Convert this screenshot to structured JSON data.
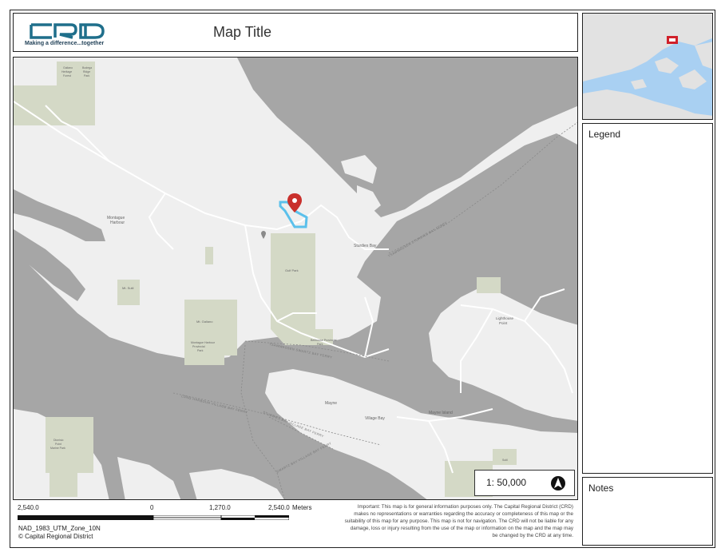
{
  "header": {
    "logo_text": "CRD",
    "logo_tagline": "Making a difference...together",
    "map_title": "Map Title"
  },
  "map": {
    "labels": {
      "montague_harbour": [
        "Montague",
        "Harbour"
      ],
      "sturdies_bay": "Sturdies Bay",
      "mt_galiano": "Mt. Galiano",
      "mt_sutil": "Mt. Sutil",
      "galiano_park": [
        "Montague Harbour",
        "Provincial",
        "Park"
      ],
      "bellhouse_park": [
        "Bellhouse Provincial",
        "Park"
      ],
      "gulf_park": "Gulf Park",
      "lighthouse_point": [
        "Lighthouse",
        "Point"
      ],
      "village_bay": "Village Bay",
      "mayne_island": "Mayne Island",
      "mayne_label": "Mayne",
      "heritage_forest": [
        "Galiano",
        "Heritage",
        "Forest"
      ],
      "dionisio": [
        "Dionisio",
        "Point",
        "Marine Park"
      ],
      "bodega": [
        "Bodega",
        "Ridge",
        "Park"
      ],
      "sutil": "Sutil"
    },
    "ferry_routes": {
      "sturdies_tsawwassen": "TSAWWASSEN STURDIES BAY FERRY",
      "tsawwassen_swartz": "TSAWWASSEN SWARTZ BAY FERRY",
      "long_harbour_village": "LONG HARBOUR VILLAGE BAY FERRY",
      "sturdies_village": "STURDIES BAY VILLAGE BAY FERRY",
      "swartz_village": "SWARTZ BAY VILLAGE BAY FERRY"
    },
    "colors": {
      "water": "#a6a6a6",
      "land": "#efefef",
      "park": "#d4d9c6",
      "road": "#ffffff",
      "marker": "#c9302c",
      "highlight": "#5bc0eb"
    }
  },
  "overview_map": {
    "colors": {
      "water": "#a9d0f2",
      "land": "#e2e2e2",
      "marker": "#d0202a"
    }
  },
  "legend": {
    "title": "Legend"
  },
  "notes": {
    "title": "Notes"
  },
  "scale": {
    "ratio_text": "1: 50,000",
    "north_icon": "north-arrow-icon",
    "bar_labels": [
      "2,540.0",
      "0",
      "1,270.0",
      "2,540.0"
    ],
    "unit": "Meters"
  },
  "footer": {
    "projection": "NAD_1983_UTM_Zone_10N",
    "copyright": "© Capital Regional District",
    "disclaimer": "Important: This map is for general information purposes only. The Capital Regional District (CRD) makes no representations or warranties regarding the accuracy or completeness of this map or the suitability of this map for any purpose. This map is not for navigation. The CRD will not be liable for any damage, loss or injury resulting from the use of the map or information on the map and the map may be changed by the CRD at any time."
  }
}
